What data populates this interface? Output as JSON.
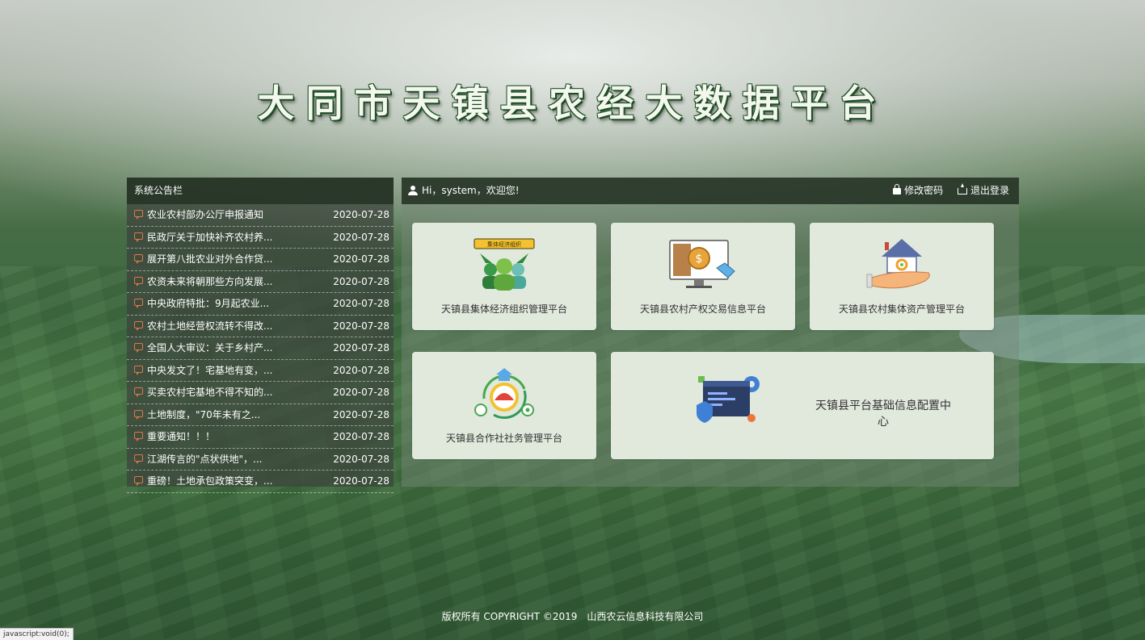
{
  "title": "大同市天镇县农经大数据平台",
  "notice": {
    "header": "系统公告栏",
    "items": [
      {
        "title": "农业农村部办公厅申报通知",
        "date": "2020-07-28"
      },
      {
        "title": "民政厅关于加快补齐农村养...",
        "date": "2020-07-28"
      },
      {
        "title": "展开第八批农业对外合作贷...",
        "date": "2020-07-28"
      },
      {
        "title": "农资未来将朝那些方向发展...",
        "date": "2020-07-28"
      },
      {
        "title": "中央政府特批：9月起农业...",
        "date": "2020-07-28"
      },
      {
        "title": "农村土地经营权流转不得改...",
        "date": "2020-07-28"
      },
      {
        "title": "全国人大审议：关于乡村产...",
        "date": "2020-07-28"
      },
      {
        "title": "中央发文了！宅基地有变，...",
        "date": "2020-07-28"
      },
      {
        "title": "买卖农村宅基地不得不知的...",
        "date": "2020-07-28"
      },
      {
        "title": "土地制度，\"70年未有之...",
        "date": "2020-07-28"
      },
      {
        "title": "重要通知！！！",
        "date": "2020-07-28"
      },
      {
        "title": "江湖传言的\"点状供地\"，...",
        "date": "2020-07-28"
      },
      {
        "title": "重磅！土地承包政策突变，...",
        "date": "2020-07-28"
      }
    ]
  },
  "header": {
    "greeting": "Hi，system，欢迎您!",
    "change_password": "修改密码",
    "logout": "退出登录"
  },
  "cards": {
    "collective_org": "天镇县集体经济组织管理平台",
    "collective_org_badge": "集体经济组织",
    "property_trade": "天镇县农村产权交易信息平台",
    "collective_asset": "天镇县农村集体资产管理平台",
    "cooperative": "天镇县合作社社务管理平台",
    "config_center": "天镇县平台基础信息配置中心"
  },
  "footer": {
    "copyright": "版权所有 COPYRIGHT ©2019",
    "company": "山西农云信息科技有限公司"
  },
  "statusbar": "javascript:void(0);"
}
